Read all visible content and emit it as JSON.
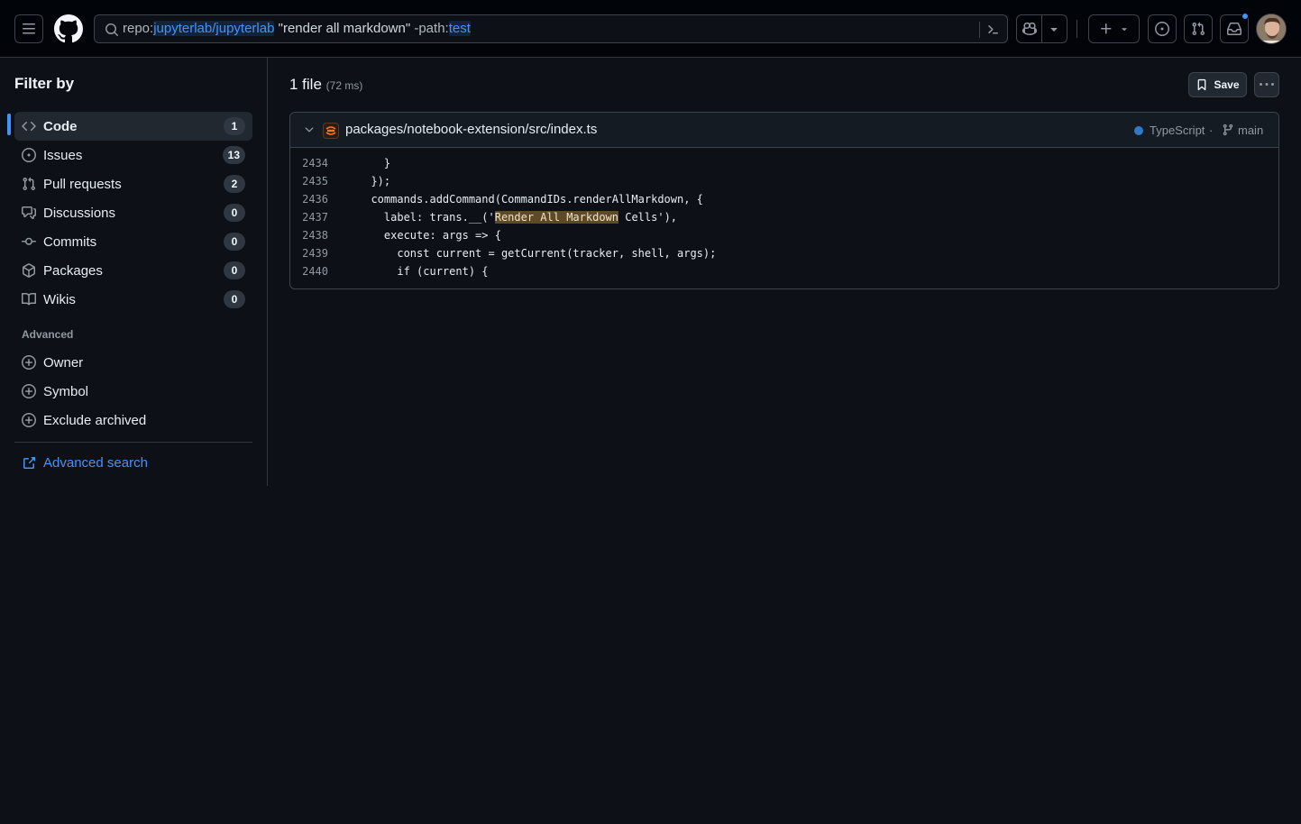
{
  "header": {
    "search": {
      "qualifier_repo": "repo:",
      "repo_value": "jupyterlab/jupyterlab",
      "quoted_term": " \"render all markdown\" ",
      "qualifier_path": "-path:",
      "path_value": "test"
    }
  },
  "sidebar": {
    "title": "Filter by",
    "items": [
      {
        "label": "Code",
        "count": "1",
        "icon": "code-icon"
      },
      {
        "label": "Issues",
        "count": "13",
        "icon": "issue-icon"
      },
      {
        "label": "Pull requests",
        "count": "2",
        "icon": "pull-request-icon"
      },
      {
        "label": "Discussions",
        "count": "0",
        "icon": "discussion-icon"
      },
      {
        "label": "Commits",
        "count": "0",
        "icon": "commit-icon"
      },
      {
        "label": "Packages",
        "count": "0",
        "icon": "package-icon"
      },
      {
        "label": "Wikis",
        "count": "0",
        "icon": "book-icon"
      }
    ],
    "advanced_heading": "Advanced",
    "advanced_items": [
      {
        "label": "Owner",
        "icon": "plus-circle-icon"
      },
      {
        "label": "Symbol",
        "icon": "plus-circle-icon"
      },
      {
        "label": "Exclude archived",
        "icon": "plus-circle-icon"
      }
    ],
    "advanced_search_label": "Advanced search"
  },
  "results": {
    "count_label": "1 file",
    "timing": "(72 ms)",
    "save_label": "Save"
  },
  "result": {
    "path": "packages/notebook-extension/src/index.ts",
    "language": "TypeScript",
    "language_color": "#3178c6",
    "separator": "·",
    "branch": "main",
    "lines": [
      {
        "num": "2434",
        "pre": "    }",
        "match": "",
        "post": ""
      },
      {
        "num": "2435",
        "pre": "  });",
        "match": "",
        "post": ""
      },
      {
        "num": "2436",
        "pre": "  commands.addCommand(CommandIDs.renderAllMarkdown, {",
        "match": "",
        "post": ""
      },
      {
        "num": "2437",
        "pre": "    label: trans.__('",
        "match": "Render All Markdown",
        "post": " Cells'),"
      },
      {
        "num": "2438",
        "pre": "    execute: args => {",
        "match": "",
        "post": ""
      },
      {
        "num": "2439",
        "pre": "      const current = getCurrent(tracker, shell, args);",
        "match": "",
        "post": ""
      },
      {
        "num": "2440",
        "pre": "      if (current) {",
        "match": "",
        "post": ""
      }
    ]
  },
  "colors": {
    "accent": "#4493f8",
    "match_highlight": "#5e4a24",
    "background": "#0d1117"
  }
}
